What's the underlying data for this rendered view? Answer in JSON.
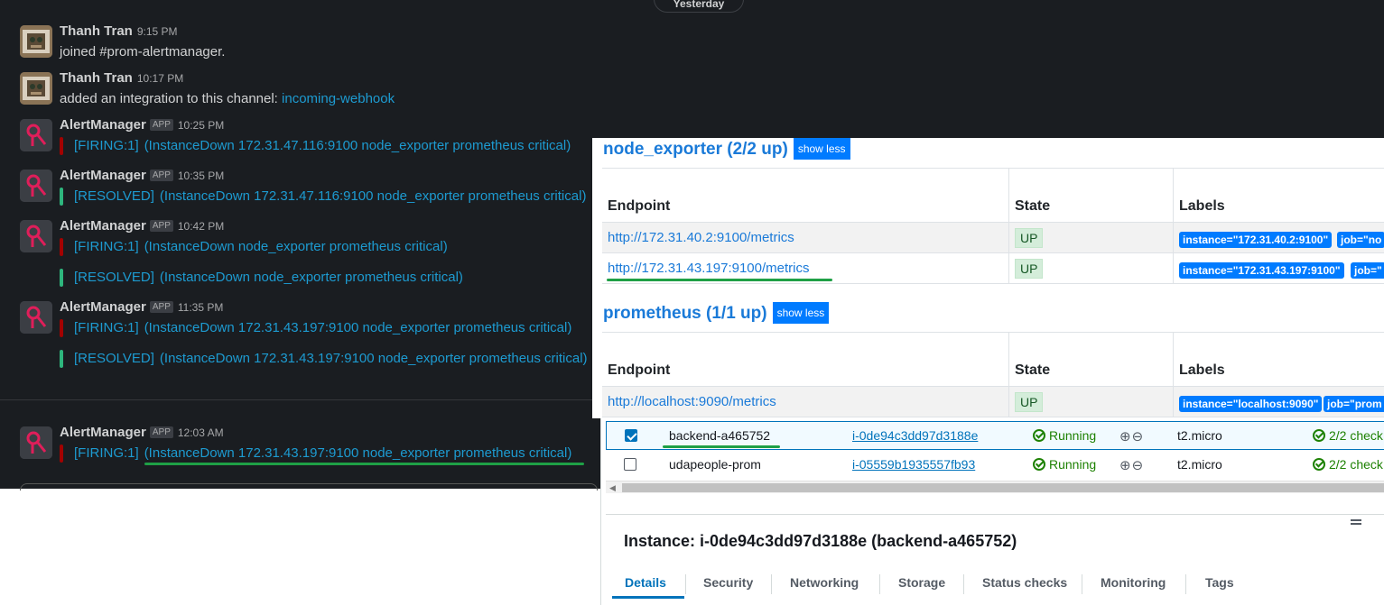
{
  "slack": {
    "date_divider": "Yesterday",
    "messages": [
      {
        "author": "Thanh Tran",
        "time": "9:15 PM",
        "text": "joined #prom-alertmanager."
      },
      {
        "author": "Thanh Tran",
        "time": "10:17 PM",
        "text": "added an integration to this channel:",
        "link": "incoming-webhook"
      },
      {
        "author": "AlertManager",
        "badge": "APP",
        "time": "10:25 PM",
        "attachments": [
          {
            "status": "[FIRING:1]",
            "text": "(InstanceDown 172.31.47.116:9100 node_exporter prometheus critical)",
            "color": "#a30200"
          }
        ]
      },
      {
        "author": "AlertManager",
        "badge": "APP",
        "time": "10:35 PM",
        "attachments": [
          {
            "status": "[RESOLVED]",
            "text": "(InstanceDown 172.31.47.116:9100 node_exporter prometheus critical)",
            "color": "#2eb67d"
          }
        ]
      },
      {
        "author": "AlertManager",
        "badge": "APP",
        "time": "10:42 PM",
        "attachments": [
          {
            "status": "[FIRING:1]",
            "text": "(InstanceDown node_exporter prometheus critical)",
            "color": "#a30200"
          },
          {
            "status": "[RESOLVED]",
            "text": "(InstanceDown node_exporter prometheus critical)",
            "color": "#2eb67d"
          }
        ]
      },
      {
        "author": "AlertManager",
        "badge": "APP",
        "time": "11:35 PM",
        "attachments": [
          {
            "status": "[FIRING:1]",
            "text": "(InstanceDown 172.31.43.197:9100 node_exporter prometheus critical)",
            "color": "#a30200"
          },
          {
            "status": "[RESOLVED]",
            "text": "(InstanceDown 172.31.43.197:9100 node_exporter prometheus critical)",
            "color": "#2eb67d"
          }
        ]
      },
      {
        "author": "AlertManager",
        "badge": "APP",
        "time": "12:03 AM",
        "attachments": [
          {
            "status": "[FIRING:1]",
            "text": "(InstanceDown 172.31.43.197:9100 node_exporter prometheus critical)",
            "color": "#a30200"
          }
        ]
      }
    ]
  },
  "prometheus": {
    "show_less": "show less",
    "columns": {
      "endpoint": "Endpoint",
      "state": "State",
      "labels": "Labels"
    },
    "groups": [
      {
        "title": "node_exporter (2/2 up)",
        "rows": [
          {
            "endpoint": "http://172.31.40.2:9100/metrics",
            "state": "UP",
            "labels": [
              "instance=\"172.31.40.2:9100\"",
              "job=\"no"
            ]
          },
          {
            "endpoint": "http://172.31.43.197:9100/metrics",
            "state": "UP",
            "labels": [
              "instance=\"172.31.43.197:9100\"",
              "job=\""
            ]
          }
        ]
      },
      {
        "title": "prometheus (1/1 up)",
        "rows": [
          {
            "endpoint": "http://localhost:9090/metrics",
            "state": "UP",
            "labels": [
              "instance=\"localhost:9090\"",
              "job=\"prom"
            ]
          }
        ]
      }
    ]
  },
  "ec2": {
    "instances": [
      {
        "name": "backend-a465752",
        "id": "i-0de94c3dd97d3188e",
        "state": "Running",
        "zoom": "⊕⊖",
        "type": "t2.micro",
        "checks": "2/2 check",
        "selected": true
      },
      {
        "name": "udapeople-prom",
        "id": "i-05559b1935557fb93",
        "state": "Running",
        "zoom": "⊕⊖",
        "type": "t2.micro",
        "checks": "2/2 check",
        "selected": false
      }
    ],
    "detail_title": "Instance: i-0de94c3dd97d3188e (backend-a465752)",
    "tabs": [
      "Details",
      "Security",
      "Networking",
      "Storage",
      "Status checks",
      "Monitoring",
      "Tags"
    ],
    "active_tab": "Details"
  },
  "colors": {
    "slack_bg": "#1a1d21",
    "slack_link": "#1d9bd1",
    "firing": "#a30200",
    "resolved": "#2eb67d",
    "prom_link": "#1a7ad8",
    "label_badge": "#007bff",
    "aws_link": "#0073bb",
    "running": "#1d8102",
    "highlight_underline": "#1fa046"
  }
}
